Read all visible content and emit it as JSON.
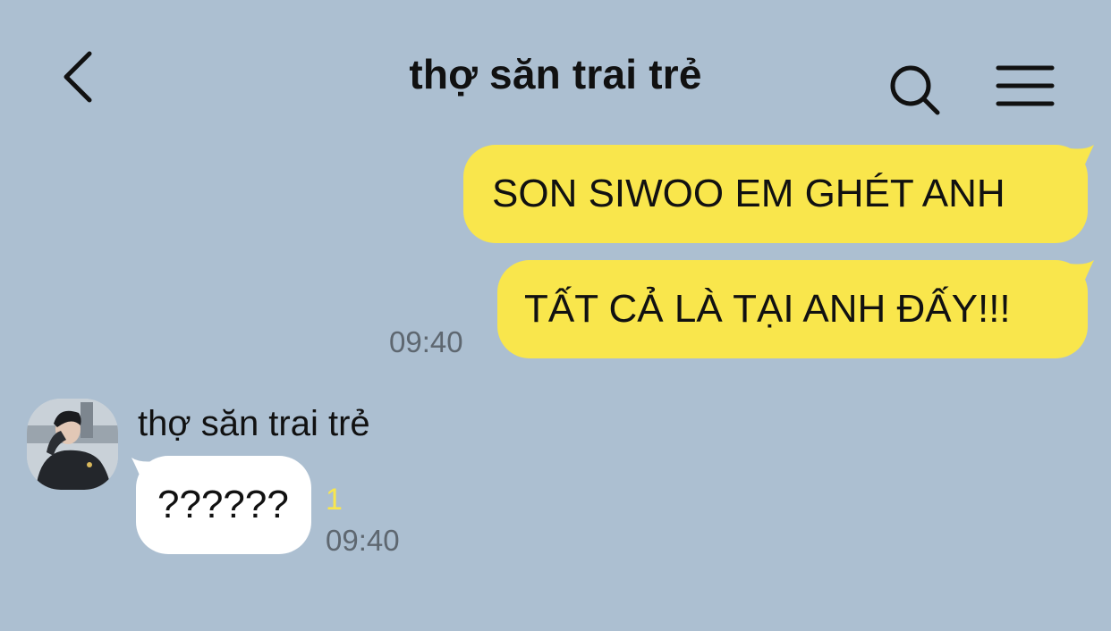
{
  "header": {
    "title": "thợ săn trai trẻ",
    "back_icon": "chevron-left-icon",
    "search_icon": "search-icon",
    "menu_icon": "hamburger-menu-icon"
  },
  "messages": {
    "sent": [
      {
        "text": "SON SIWOO EM GHÉT ANH"
      },
      {
        "text": "TẤT CẢ LÀ TẠI ANH ĐẤY!!!",
        "time": "09:40"
      }
    ],
    "received": {
      "sender": "thợ săn trai trẻ",
      "avatar_icon": "profile-photo",
      "text": "??????",
      "unread_count": "1",
      "time": "09:40"
    }
  },
  "colors": {
    "background": "#acbfd1",
    "sent_bubble": "#f9e64c",
    "received_bubble": "#ffffff",
    "unread": "#f8e64e",
    "timestamp": "#5e6770"
  }
}
